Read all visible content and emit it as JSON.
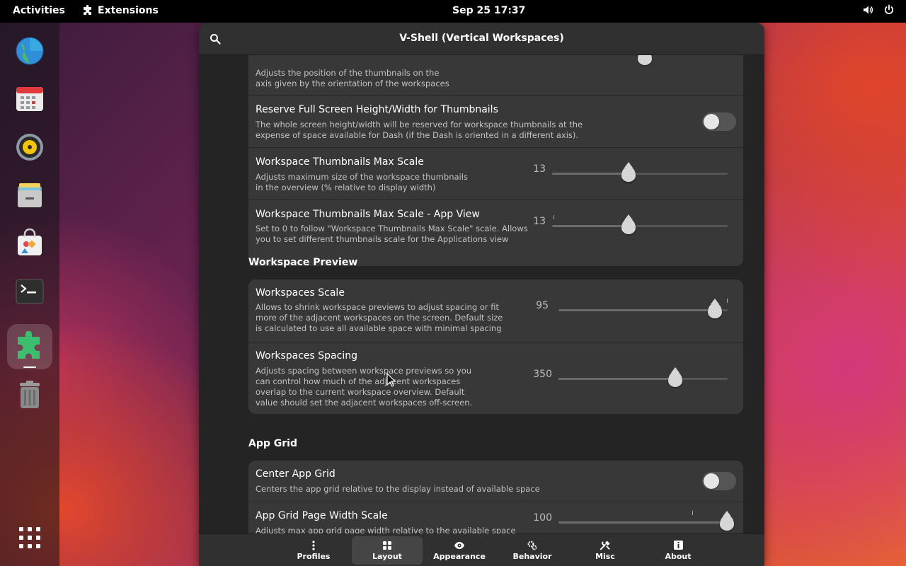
{
  "topbar": {
    "activities": "Activities",
    "extensions": "Extensions",
    "clock": "Sep 25  17:37",
    "icons": [
      "volume-icon",
      "power-icon"
    ]
  },
  "dock": {
    "apps": [
      "browser-icon",
      "calendar-icon",
      "music-icon",
      "files-icon",
      "software-icon",
      "terminal-icon",
      "extensions-icon",
      "trash-icon"
    ],
    "active_app": "extensions-icon",
    "show_apps_icon": "apps-grid-icon"
  },
  "window": {
    "title": "V-Shell (Vertical Workspaces)",
    "search_icon": "search-icon"
  },
  "group1": {
    "row0": {
      "sub": "Adjusts the position of the thumbnails on the\naxis given by the orientation of the workspaces"
    },
    "row1": {
      "title": "Reserve Full Screen Height/Width for Thumbnails",
      "sub": "The whole screen height/width will be reserved for workspace thumbnails at the\nexpense of space available for Dash (if the Dash is oriented in a different axis).",
      "enabled": false
    },
    "row2": {
      "title": "Workspace Thumbnails Max Scale",
      "sub": "Adjusts maximum size of the workspace thumbnails\nin the overview (% relative to display width)",
      "value": "13"
    },
    "row3": {
      "title": "Workspace Thumbnails Max Scale - App View",
      "sub": "Set to 0 to follow \"Workspace Thumbnails Max Scale\" scale. Allows\nyou to set different thumbnails scale for the Applications view",
      "value": "13"
    }
  },
  "section_preview": "Workspace Preview",
  "group2": {
    "row1": {
      "title": "Workspaces Scale",
      "sub": "Allows to shrink workspace previews to adjust spacing or fit\nmore of the adjacent workspaces on the screen. Default size\nis calculated to use all available space with minimal spacing",
      "value": "95"
    },
    "row2": {
      "title": "Workspaces Spacing",
      "sub": "Adjusts spacing between workspace previews so you\ncan control how much of the adjacent workspaces\noverlap to the current workspace overview. Default\nvalue should set the adjacent workspaces off-screen.",
      "value": "350"
    }
  },
  "section_appgrid": "App Grid",
  "group3": {
    "row1": {
      "title": "Center App Grid",
      "sub": "Centers the app grid relative to the display instead of available space",
      "enabled": false
    },
    "row2": {
      "title": "App Grid Page Width Scale",
      "sub": "Adjusts max app grid page width relative to the available space",
      "value": "100"
    }
  },
  "tabs": [
    {
      "label": "Profiles",
      "icon": "more-vertical-icon"
    },
    {
      "label": "Layout",
      "icon": "grid-icon"
    },
    {
      "label": "Appearance",
      "icon": "eye-icon"
    },
    {
      "label": "Behavior",
      "icon": "gears-icon"
    },
    {
      "label": "Misc",
      "icon": "tools-icon"
    },
    {
      "label": "About",
      "icon": "info-icon"
    }
  ],
  "active_tab": "Layout"
}
